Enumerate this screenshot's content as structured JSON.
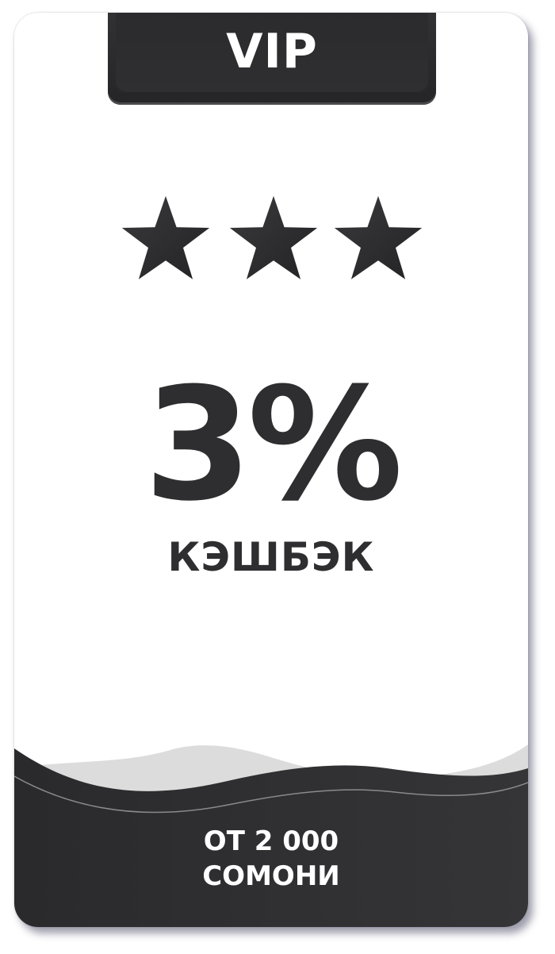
{
  "card": {
    "tier_label": "VIP",
    "stars": {
      "rating": 3,
      "max": 3,
      "icon": "star-icon",
      "color": "#2f2f31"
    },
    "cashback_value": "3%",
    "cashback_label": "КЭШБЭК",
    "footer": {
      "line1": "ОТ 2 000",
      "line2": "СОМОНИ"
    },
    "colors": {
      "dark": "#2e2e30",
      "wave_light": "#dcdcdc",
      "background": "#ffffff"
    }
  }
}
